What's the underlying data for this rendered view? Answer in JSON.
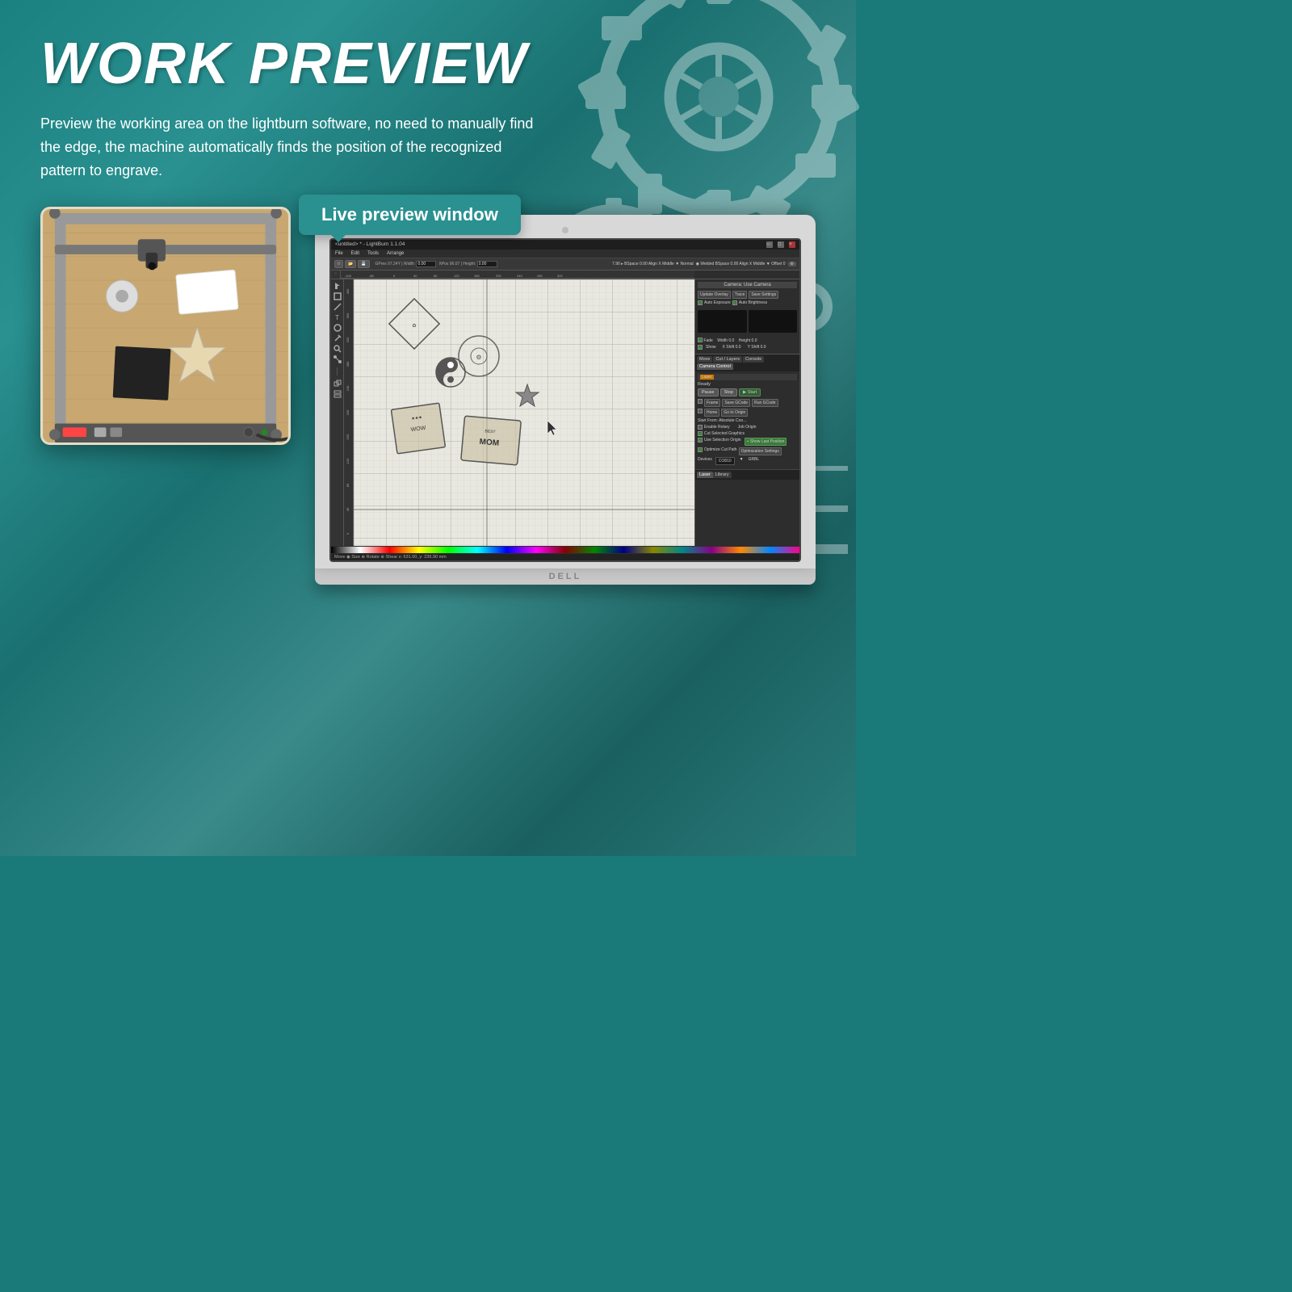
{
  "page": {
    "title": "WORK PREVIEW",
    "description": "Preview the working area on the lightburn software, no need to manually find the edge, the machine automatically finds the position of the recognized pattern to engrave.",
    "live_preview_label": "Live preview window",
    "background_color": "#1a8080"
  },
  "lightburn": {
    "title": "<untitled> * - LightBurn 1.1.04",
    "menu_items": [
      "File",
      "Edit",
      "Tools",
      "Arrange"
    ],
    "tabs": [
      "Move",
      "Cut / Layers",
      "Console",
      "Camera Control"
    ],
    "laser_tabs": [
      "Laser",
      "Library"
    ],
    "camera_title": "Camera: Use Camera",
    "buttons": {
      "update_overlay": "Update Overlay",
      "trace": "Trace",
      "save_settings": "Save Settings",
      "auto_exposure": "Auto Exposure",
      "auto_brightness": "Auto Brightness",
      "fade": "Fade",
      "show": "Show",
      "pause": "Pause",
      "stop": "Stop",
      "start": "Start",
      "frame": "Frame",
      "save_gcode": "Save GCode",
      "run_gcode": "Run GCode",
      "home": "Home",
      "go_to_origin": "Go to Origin",
      "start_from": "Start From: Absolute Coo...",
      "show_last_position": "+ Show Last Position",
      "cut_selected": "Cut Selected Graphics",
      "use_selection_origin": "Use Selection Origin",
      "optimize_cut_path": "Optimize Cut Path",
      "optimization_settings": "Optimization Settings",
      "enable_rotary": "Enable Rotary",
      "job_origin": "Job Origin"
    },
    "laser_fields": {
      "width": "Width 0.0",
      "height": "Height 0.0",
      "x_shift": "X Shift 0.0",
      "y_shift": "Y Shift 0.0"
    },
    "devices_label": "Devices",
    "device_value": "CO810",
    "grbl_label": "GRBL",
    "status": "Ready",
    "statusbar": "Move ◉ Size ⊕ Rotate ⊕ Shear    x: 631.00, y: 236.90 mm"
  },
  "brand": "DELL"
}
